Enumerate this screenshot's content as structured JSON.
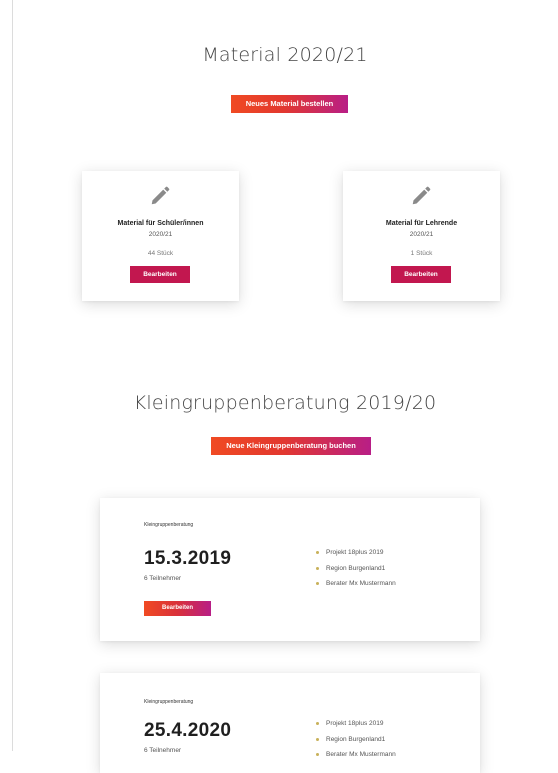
{
  "material": {
    "title": "Material 2020/21",
    "order_button": "Neues Material bestellen",
    "cards": [
      {
        "icon": "pencil-icon",
        "title": "Material für Schüler/innen",
        "year": "2020/21",
        "count": "44 Stück",
        "edit_label": "Bearbeiten"
      },
      {
        "icon": "pencil-icon",
        "title": "Material für Lehrende",
        "year": "2020/21",
        "count": "1 Stück",
        "edit_label": "Bearbeiten"
      }
    ]
  },
  "consulting": {
    "title": "Kleingruppenberatung 2019/20",
    "book_button": "Neue Kleingruppenberatung buchen",
    "bookings": [
      {
        "label": "Kleingruppenberatung",
        "date": "15.3.2019",
        "participants": "6 Teilnehmer",
        "edit_label": "Bearbeiten",
        "details": [
          "Projekt 18plus 2019",
          "Region Burgenland1",
          "Berater Mx Mustermann"
        ]
      },
      {
        "label": "Kleingruppenberatung",
        "date": "25.4.2020",
        "participants": "6 Teilnehmer",
        "details": [
          "Projekt 18plus 2019",
          "Region Burgenland1",
          "Berater Mx Mustermann"
        ]
      }
    ]
  },
  "colors": {
    "accent_orange": "#f04a23",
    "accent_purple": "#b81e86",
    "edit_crimson": "#c2174f",
    "bullet": "#c8b15a"
  }
}
